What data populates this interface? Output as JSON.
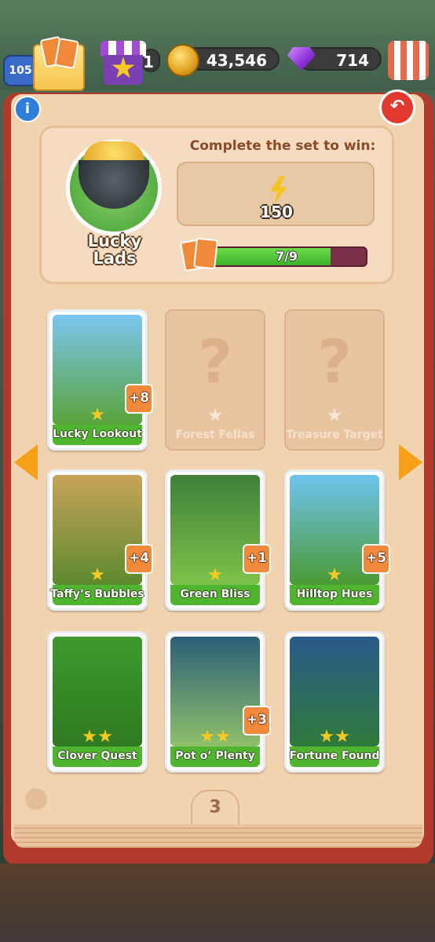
{
  "hud": {
    "level": "105",
    "lives_partial": "1",
    "coins": "43,546",
    "gems": "714"
  },
  "album": {
    "set_name": "Lucky Lads",
    "complete_label": "Complete the set to win:",
    "reward_value": "150",
    "progress_text": "7/9",
    "progress_fraction": 0.7778,
    "page_number": "3"
  },
  "cards": [
    {
      "name": "Lucky Lookout",
      "stars": 1,
      "owned": true,
      "dup": "+8",
      "art": [
        "#7bc6f0",
        "#5aa33a"
      ]
    },
    {
      "name": "Forest Fellas",
      "stars": 1,
      "owned": false,
      "dup": "",
      "art": []
    },
    {
      "name": "Treasure Target",
      "stars": 1,
      "owned": false,
      "dup": "",
      "art": []
    },
    {
      "name": "Taffy’s Bubbles",
      "stars": 1,
      "owned": true,
      "dup": "+4",
      "art": [
        "#c9a35a",
        "#5d8a2e"
      ]
    },
    {
      "name": "Green Bliss",
      "stars": 1,
      "owned": true,
      "dup": "+1",
      "art": [
        "#3f7f3a",
        "#7fc24a"
      ]
    },
    {
      "name": "Hilltop Hues",
      "stars": 1,
      "owned": true,
      "dup": "+5",
      "art": [
        "#6fc4f0",
        "#4a9a32"
      ]
    },
    {
      "name": "Clover Quest",
      "stars": 2,
      "owned": true,
      "dup": "",
      "art": [
        "#3e9a2c",
        "#2f7a22"
      ]
    },
    {
      "name": "Pot o’ Plenty",
      "stars": 2,
      "owned": true,
      "dup": "+3",
      "art": [
        "#2c5e78",
        "#8ec06a"
      ]
    },
    {
      "name": "Fortune Found",
      "stars": 2,
      "owned": true,
      "dup": "",
      "art": [
        "#2a5a8a",
        "#2e7a3a"
      ]
    }
  ],
  "colors": {
    "page": "#f1d3b0",
    "book_cover": "#b23a2c",
    "name_band": "#4fb52e",
    "progress_fill": "#3bb22a",
    "accent_orange": "#f6a019"
  },
  "icons": [
    "info-icon",
    "back-arrow-icon",
    "bolt-icon",
    "card-stack-icon",
    "star-icon",
    "prev-page-arrow",
    "next-page-arrow",
    "tulip-icon",
    "coin-icon",
    "gem-icon",
    "shop-icon",
    "envelope-icon"
  ]
}
